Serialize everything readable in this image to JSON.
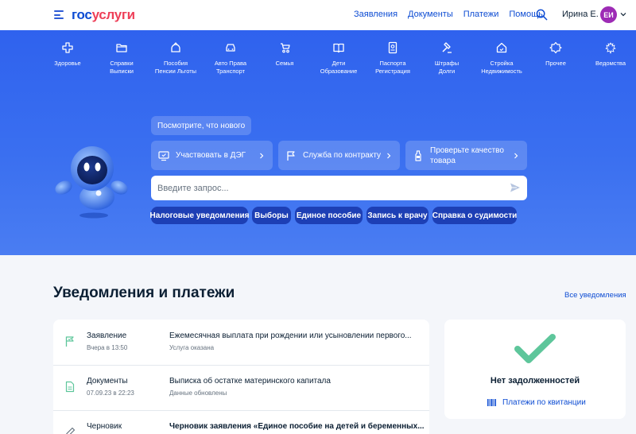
{
  "header": {
    "logo_part1": "гос",
    "logo_part2": "услуги",
    "nav": [
      "Заявления",
      "Документы",
      "Платежи",
      "Помощь"
    ],
    "user_name": "Ирина Е.",
    "avatar_initials": "ЕИ"
  },
  "categories": [
    {
      "label": "Здоровье",
      "icon": "health-cross-icon"
    },
    {
      "label": "Справки\nВыписки",
      "icon": "folder-icon"
    },
    {
      "label": "Пособия\nПенсии Льготы",
      "icon": "wallet-icon"
    },
    {
      "label": "Авто Права\nТранспорт",
      "icon": "car-icon"
    },
    {
      "label": "Семья",
      "icon": "stroller-icon"
    },
    {
      "label": "Дети\nОбразование",
      "icon": "book-icon"
    },
    {
      "label": "Паспорта\nРегистрация",
      "icon": "passport-icon"
    },
    {
      "label": "Штрафы\nДолги",
      "icon": "gavel-icon"
    },
    {
      "label": "Стройка\nНедвижимость",
      "icon": "house-icon"
    },
    {
      "label": "Прочее",
      "icon": "grid-icon"
    },
    {
      "label": "Ведомства",
      "icon": "emblem-icon"
    }
  ],
  "hero": {
    "whats_new": "Посмотрите, что нового",
    "promos": [
      {
        "label": "Участвовать в ДЭГ",
        "icon": "vote-screen-icon"
      },
      {
        "label": "Служба по контракту",
        "icon": "flag-icon"
      },
      {
        "label": "Проверьте качество товара",
        "icon": "bottle-icon"
      }
    ],
    "search_placeholder": "Введите запрос...",
    "chips": [
      "Налоговые уведомления",
      "Выборы",
      "Единое пособие",
      "Запись к врачу",
      "Справка о судимости"
    ]
  },
  "notifications": {
    "title": "Уведомления и платежи",
    "all_link": "Все уведомления",
    "items": [
      {
        "type": "Заявление",
        "time": "Вчера в 13:50",
        "title": "Ежемесячная выплата при рождении или усыновлении первого...",
        "status": "Услуга оказана",
        "icon": "flag-icon"
      },
      {
        "type": "Документы",
        "time": "07.09.23 в 22:23",
        "title": "Выписка об остатке материнского капитала",
        "status": "Данные обновлены",
        "icon": "document-icon"
      },
      {
        "type": "Черновик",
        "time": "",
        "title": "Черновик заявления «Единое пособие на детей и беременных...",
        "status": "",
        "icon": "pencil-icon"
      }
    ]
  },
  "debt": {
    "title": "Нет задолженностей",
    "link": "Платежи по квитанции"
  },
  "colors": {
    "brand_blue": "#0d4cd3",
    "brand_red": "#ee3f58",
    "hero_bg": "#3a6ff0",
    "chip_bg": "#1d3fb5",
    "success_green": "#5ec69b"
  }
}
